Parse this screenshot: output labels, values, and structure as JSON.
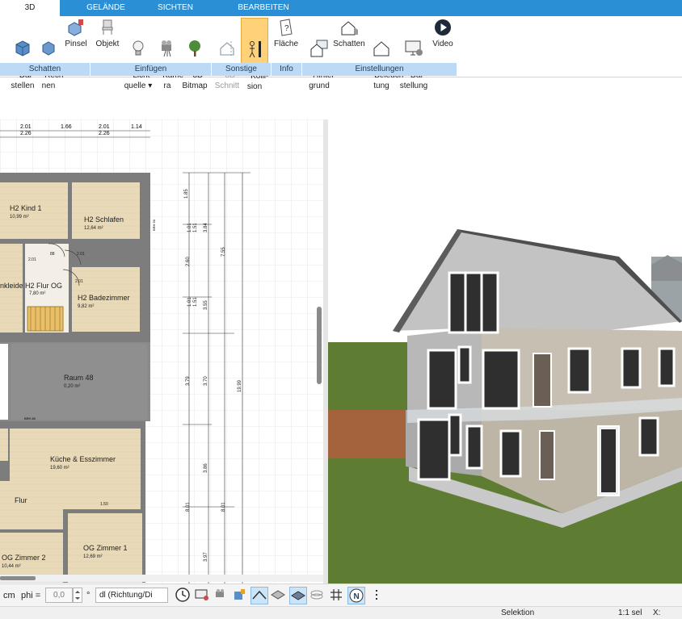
{
  "tabs": [
    {
      "label": "3D",
      "active": true
    },
    {
      "label": "GELÄNDE"
    },
    {
      "label": "SICHTEN"
    },
    {
      "label": "BEARBEITEN"
    }
  ],
  "ribbon": {
    "buttons": {
      "darstellen": "Dar-\nstellen",
      "rechnen": "Rech-\nnen",
      "pinsel": "Pinsel",
      "objekt": "Objekt",
      "lichtquelle": "Licht-\nquelle ▾",
      "kamera": "Kame-\nra",
      "bitmap": "3D-\nBitmap",
      "schnitt": "3D-\nSchnitt",
      "kollision": "Kolli-\nsion",
      "flaeche": "Fläche",
      "hintergrund": "Hinter-\ngrund",
      "schatten_btn": "Schatten",
      "beleuchtung": "Beleuch-\ntung",
      "darstellung": "Dar-\nstellung",
      "video": "Video"
    },
    "groups": {
      "schatten": "Schatten",
      "einfuegen": "Einfügen",
      "sonstige": "Sonstige",
      "info": "Info",
      "einstellungen": "Einstellungen"
    }
  },
  "plan": {
    "rooms": [
      {
        "name": "H2 Kind 1",
        "area": "10,99 m²"
      },
      {
        "name": "H2 Schlafen",
        "area": "12,64 m²"
      },
      {
        "name": "nkleide H2 Flur OG",
        "area": "7,80 m²"
      },
      {
        "name": "H2 Badezimmer",
        "area": "9,82 m²"
      },
      {
        "name": "Raum 48",
        "area": "0,20 m²"
      },
      {
        "name": "Küche & Esszimmer",
        "area": "19,60 m²"
      },
      {
        "name": "Flur",
        "area": ""
      },
      {
        "name": "OG Zimmer 2",
        "area": "10,44 m²"
      },
      {
        "name": "OG Zimmer 1",
        "area": "12,69 m²"
      }
    ],
    "dims_top": [
      "2.01",
      "2.26",
      "1.66",
      "2.01",
      "2.26",
      "1.14"
    ],
    "dims_vertical": [
      "1.85",
      "1.01",
      "1.51",
      "3.84",
      "2.60",
      "7.55",
      "1.01",
      "1.51",
      "3.55",
      "3.79",
      "3.70",
      "19.99",
      "3.86",
      "8.01",
      "8.01",
      "3.97"
    ],
    "small_labels": [
      "BRH 90",
      "BRH 80"
    ],
    "door_labels": [
      "2.01",
      "88",
      "2.01",
      "2.01",
      "1.50"
    ]
  },
  "bottom_toolbar": {
    "unit": "cm",
    "phi_label": "phi =",
    "phi_value": "0,0",
    "degree": "°",
    "direction": "dl (Richtung/Di"
  },
  "status": {
    "mode": "Selektion",
    "scale": "1:1 sel",
    "x": "X:"
  },
  "colors": {
    "tab_bar": "#2b8fd6",
    "group_label_bg": "#bcdaf5",
    "active_button": "#ffd27a",
    "floor_wood": "#e6d7b6",
    "wall_grey": "#7d7d7d",
    "grass": "#5e7d33"
  }
}
